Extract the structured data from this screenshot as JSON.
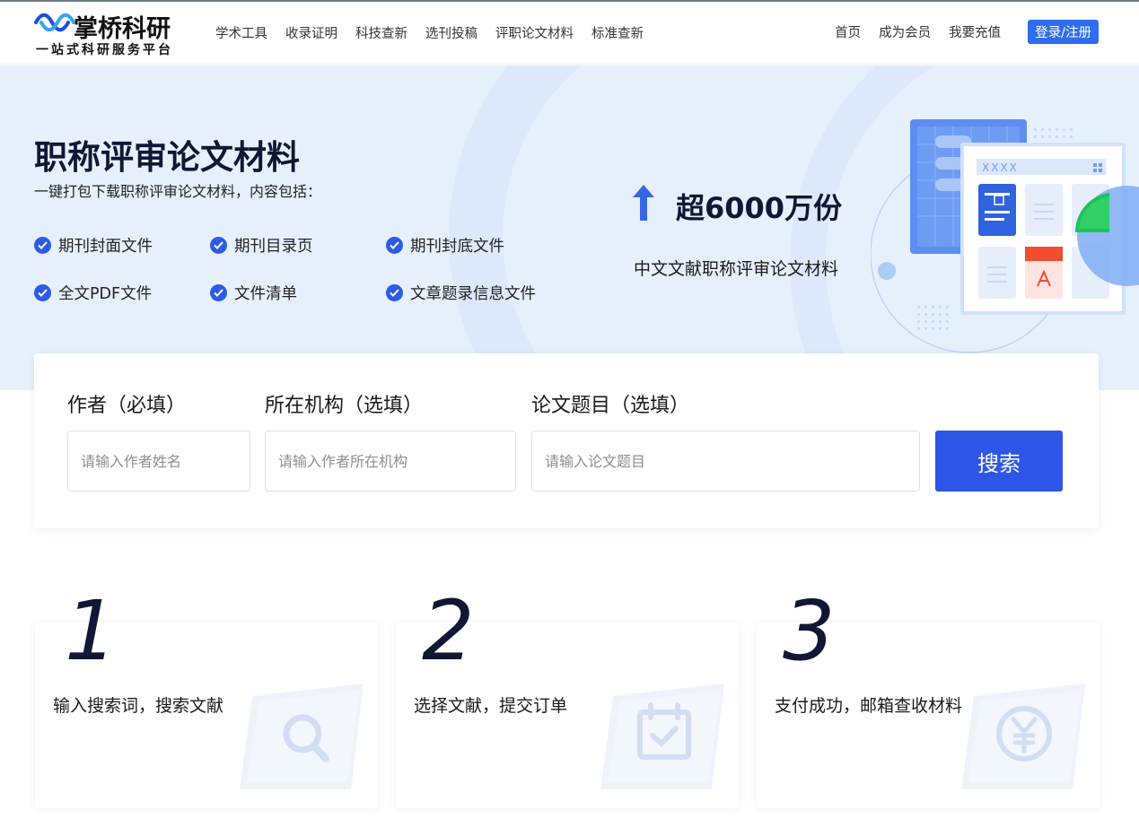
{
  "brand": {
    "name": "掌桥科研",
    "tagline": "一站式科研服务平台"
  },
  "nav": {
    "items": [
      "学术工具",
      "收录证明",
      "科技查新",
      "选刊投稿",
      "评职论文材料",
      "标准查新"
    ],
    "right": [
      "首页",
      "成为会员",
      "我要充值"
    ],
    "login_label": "登录/注册"
  },
  "hero": {
    "title": "职称评审论文材料",
    "desc": "一键打包下载职称评审论文材料，内容包括：",
    "features": [
      "期刊封面文件",
      "期刊目录页",
      "期刊封底文件",
      "全文PDF文件",
      "文件清单",
      "文章题录信息文件"
    ],
    "stat_value": "超6000万份",
    "stat_desc": "中文文献职称评审论文材料",
    "illustration_label": "XXXX"
  },
  "search": {
    "author_label": "作者（必填）",
    "author_placeholder": "请输入作者姓名",
    "org_label": "所在机构（选填）",
    "org_placeholder": "请输入作者所在机构",
    "title_label": "论文题目（选填）",
    "title_placeholder": "请输入论文题目",
    "button_label": "搜索"
  },
  "steps": [
    {
      "num": "1",
      "text": "输入搜索词，搜索文献",
      "icon": "search-icon"
    },
    {
      "num": "2",
      "text": "选择文献，提交订单",
      "icon": "calendar-check-icon"
    },
    {
      "num": "3",
      "text": "支付成功，邮箱查收材料",
      "icon": "yuan-icon"
    }
  ],
  "colors": {
    "primary": "#2d55e8",
    "hero_bg": "#e6f0fd",
    "login_btn": "#2f6df0",
    "dark_text": "#0e1733"
  }
}
